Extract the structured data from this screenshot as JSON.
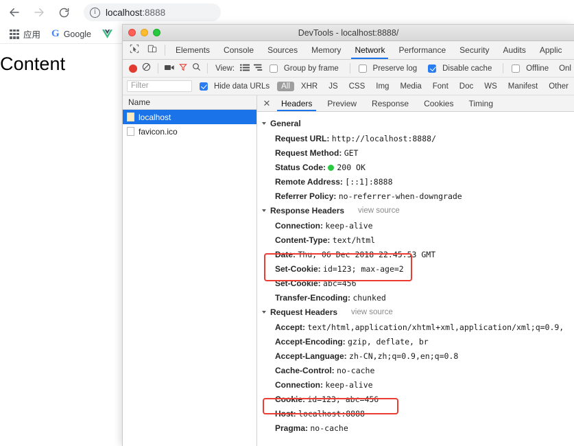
{
  "browser": {
    "back_icon": "arrow-left-icon",
    "forward_icon": "arrow-right-icon",
    "reload_icon": "reload-icon",
    "site_info_icon": "info-circle-icon",
    "url_host": "localhost",
    "url_port": ":8888",
    "bookmarks": [
      {
        "icon": "apps-grid-icon",
        "label": "应用"
      },
      {
        "icon": "google-g-icon",
        "label": "Google"
      },
      {
        "icon": "vue-logo-icon",
        "label": ""
      }
    ]
  },
  "page": {
    "heading": "Content"
  },
  "devtools": {
    "window_title": "DevTools - localhost:8888/",
    "traffic_lights": [
      "close",
      "minimize",
      "zoom"
    ],
    "left_tool_icons": [
      "inspect-element-icon",
      "device-toolbar-icon"
    ],
    "tabs": [
      {
        "label": "Elements",
        "active": false
      },
      {
        "label": "Console",
        "active": false
      },
      {
        "label": "Sources",
        "active": false
      },
      {
        "label": "Memory",
        "active": false
      },
      {
        "label": "Network",
        "active": true
      },
      {
        "label": "Performance",
        "active": false
      },
      {
        "label": "Security",
        "active": false
      },
      {
        "label": "Audits",
        "active": false
      },
      {
        "label": "Applic",
        "active": false
      }
    ],
    "network_toolbar": {
      "record_icon": "record-button-icon",
      "clear_icon": "clear-icon",
      "capture_screenshots_icon": "camera-icon",
      "filter_icon": "funnel-icon",
      "search_icon": "search-icon",
      "view_label": "View:",
      "view_list_icon": "list-view-icon",
      "view_waterfall_icon": "waterfall-view-icon",
      "group_by_frame_label": "Group by frame",
      "group_by_frame_checked": false,
      "preserve_log_label": "Preserve log",
      "preserve_log_checked": false,
      "disable_cache_label": "Disable cache",
      "disable_cache_checked": true,
      "offline_label": "Offline",
      "offline_checked": false,
      "throttle_label": "Onl"
    },
    "filter_bar": {
      "filter_placeholder": "Filter",
      "filter_value": "",
      "hide_data_urls_label": "Hide data URLs",
      "hide_data_urls_checked": true,
      "type_chips": [
        "All",
        "XHR",
        "JS",
        "CSS",
        "Img",
        "Media",
        "Font",
        "Doc",
        "WS",
        "Manifest",
        "Other"
      ],
      "active_chip": "All"
    },
    "request_list": {
      "column_header": "Name",
      "rows": [
        {
          "name": "localhost",
          "selected": true
        },
        {
          "name": "favicon.ico",
          "selected": false
        }
      ]
    },
    "detail_tabs": [
      {
        "label": "Headers",
        "active": true
      },
      {
        "label": "Preview",
        "active": false
      },
      {
        "label": "Response",
        "active": false
      },
      {
        "label": "Cookies",
        "active": false
      },
      {
        "label": "Timing",
        "active": false
      }
    ],
    "close_icon": "close-icon",
    "sections": [
      {
        "title": "General",
        "view_source": "",
        "rows": [
          {
            "key": "Request URL:",
            "value": "http://localhost:8888/"
          },
          {
            "key": "Request Method:",
            "value": "GET"
          },
          {
            "key": "Status Code:",
            "value": "200 OK",
            "status_dot": true
          },
          {
            "key": "Remote Address:",
            "value": "[::1]:8888"
          },
          {
            "key": "Referrer Policy:",
            "value": "no-referrer-when-downgrade"
          }
        ]
      },
      {
        "title": "Response Headers",
        "view_source": "view source",
        "rows": [
          {
            "key": "Connection:",
            "value": "keep-alive"
          },
          {
            "key": "Content-Type:",
            "value": "text/html"
          },
          {
            "key": "Date:",
            "value": "Thu, 06 Dec 2018 22:45:53 GMT"
          },
          {
            "key": "Set-Cookie:",
            "value": "id=123; max-age=2",
            "highlighted": true
          },
          {
            "key": "Set-Cookie:",
            "value": "abc=456",
            "highlighted": true
          },
          {
            "key": "Transfer-Encoding:",
            "value": "chunked"
          }
        ]
      },
      {
        "title": "Request Headers",
        "view_source": "view source",
        "rows": [
          {
            "key": "Accept:",
            "value": "text/html,application/xhtml+xml,application/xml;q=0.9,"
          },
          {
            "key": "Accept-Encoding:",
            "value": "gzip, deflate, br"
          },
          {
            "key": "Accept-Language:",
            "value": "zh-CN,zh;q=0.9,en;q=0.8"
          },
          {
            "key": "Cache-Control:",
            "value": "no-cache"
          },
          {
            "key": "Connection:",
            "value": "keep-alive"
          },
          {
            "key": "Cookie:",
            "value": "id=123; abc=456",
            "highlighted": true
          },
          {
            "key": "Host:",
            "value": "localhost:8888"
          },
          {
            "key": "Pragma:",
            "value": "no-cache"
          }
        ]
      }
    ],
    "annotation_color": "#ec3b31"
  }
}
